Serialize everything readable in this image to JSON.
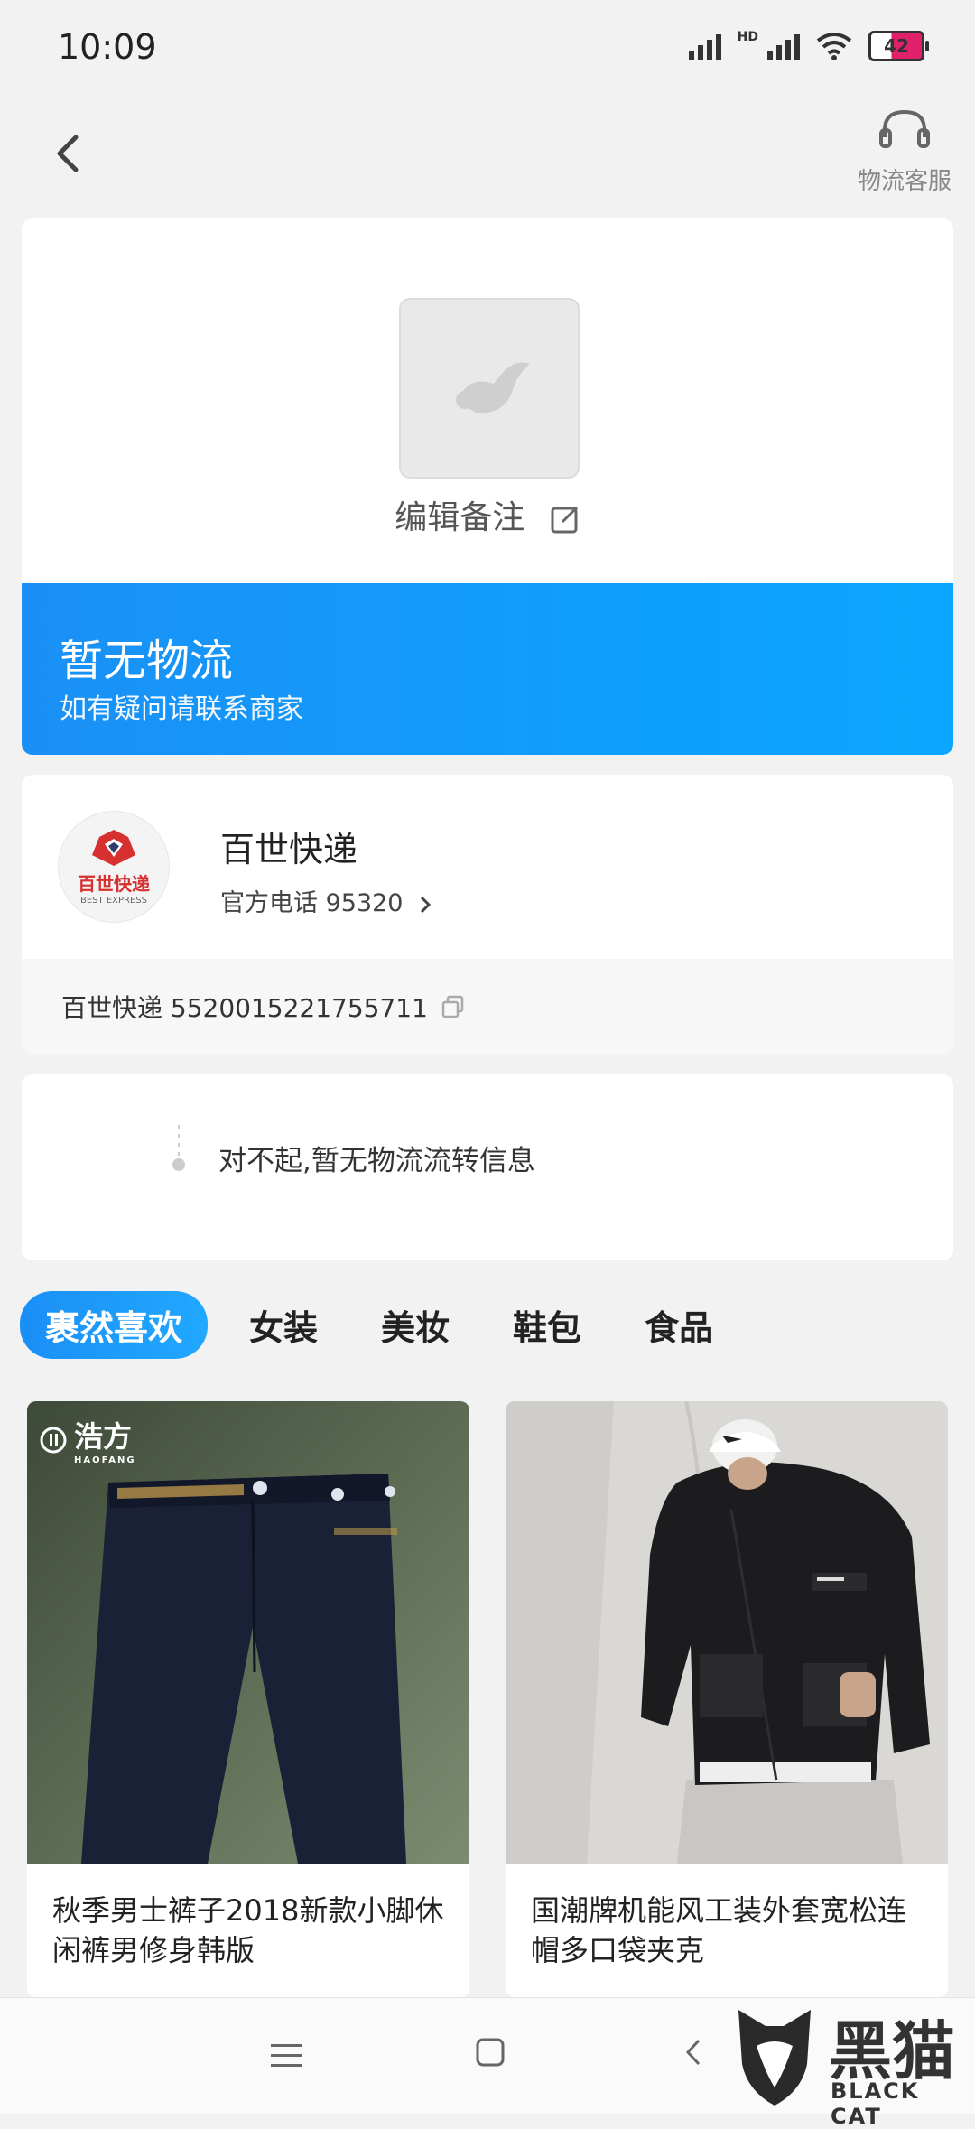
{
  "status": {
    "time": "10:09",
    "battery": "42",
    "hd_label": "HD"
  },
  "header": {
    "customer_service_label": "物流客服"
  },
  "package": {
    "edit_note_label": "编辑备注"
  },
  "banner": {
    "title": "暂无物流",
    "subtitle": "如有疑问请联系商家"
  },
  "carrier": {
    "name": "百世快递",
    "logo_cn": "百世快递",
    "logo_en": "BEST EXPRESS",
    "phone_label": "官方电话 95320",
    "tracking_line": "百世快递 5520015221755711"
  },
  "message": {
    "text": "对不起,暂无物流流转信息"
  },
  "tabs": [
    {
      "label": "裹然喜欢",
      "active": true
    },
    {
      "label": "女装"
    },
    {
      "label": "美妆"
    },
    {
      "label": "鞋包"
    },
    {
      "label": "食品"
    }
  ],
  "products": [
    {
      "title": "秋季男士裤子2018新款小脚休闲裤男修身韩版",
      "brand": "浩方",
      "brand_en": "HAOFANG"
    },
    {
      "title": "国潮牌机能风工装外套宽松连帽多口袋夹克"
    }
  ],
  "watermark": {
    "cn": "黑猫",
    "en": "BLACK CAT"
  }
}
